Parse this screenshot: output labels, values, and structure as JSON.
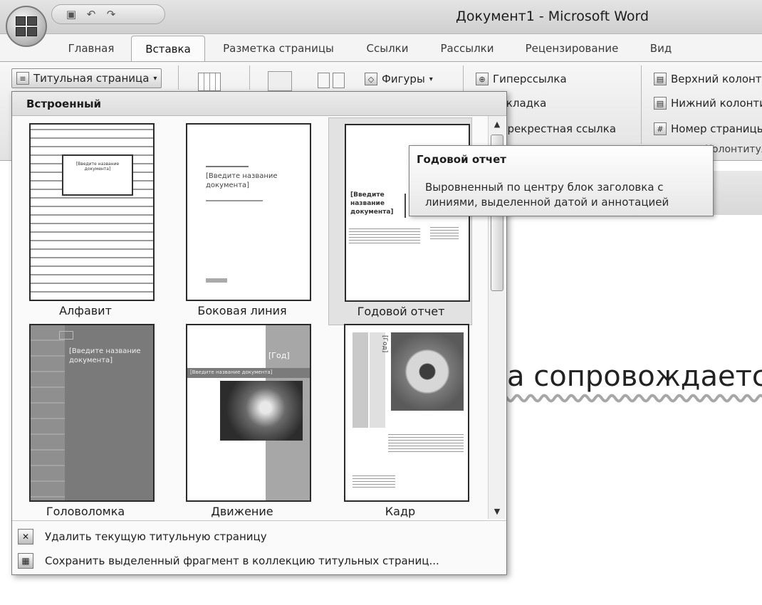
{
  "window": {
    "title": "Документ1 - Microsoft Word"
  },
  "quick_access": {
    "icons": [
      "save-icon",
      "undo-icon",
      "redo-icon"
    ]
  },
  "tabs": [
    "Главная",
    "Вставка",
    "Разметка страницы",
    "Ссылки",
    "Рассылки",
    "Рецензирование",
    "Вид"
  ],
  "active_tab": "Вставка",
  "ribbon": {
    "cover_page": "Титульная страница",
    "shapes": "Фигуры",
    "hyperlink": "Гиперссылка",
    "bookmark": "Закладка",
    "cross_ref": "Перекрестная ссылка",
    "header": "Верхний колонтитул",
    "footer": "Нижний колонтитул",
    "page_number": "Номер страницы",
    "header_footer_group": "Колонтитулы"
  },
  "gallery": {
    "heading": "Встроенный",
    "items": [
      {
        "label": "Алфавит"
      },
      {
        "label": "Боковая линия"
      },
      {
        "label": "Годовой отчет"
      },
      {
        "label": "Головоломка"
      },
      {
        "label": "Движение"
      },
      {
        "label": "Кадр"
      }
    ],
    "thumb_text": {
      "title_placeholder": "[Введите название документа]",
      "year": "[Год]"
    },
    "remove_label": "Удалить текущую титульную страницу",
    "save_label": "Сохранить выделенный фрагмент в коллекцию титульных страниц..."
  },
  "tooltip": {
    "title": "Годовой отчет",
    "text": "Выровненный по центру блок заголовка с линиями, выделенной датой и аннотацией"
  },
  "document": {
    "visible_text": "а сопровождается"
  },
  "colors": {
    "dark_fill": "#6d6d6d",
    "mid_fill": "#a0a0a0",
    "accent_gray": "#8a8a8a"
  }
}
